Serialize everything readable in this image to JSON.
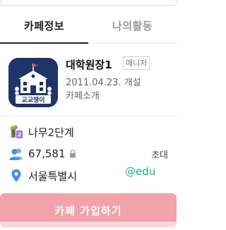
{
  "tabs": [
    {
      "label": "카페정보",
      "active": true
    },
    {
      "label": "나의활동",
      "active": false
    }
  ],
  "profile": {
    "logo_text": "교교쟁이",
    "name": "대학원장1",
    "role": "매니저",
    "created": "2011.04.23. 개설",
    "intro_link": "카페소개"
  },
  "info": {
    "level": "나무2단계",
    "level_icon": "tree-level-icon",
    "members": "67,581",
    "members_icon": "members-icon",
    "invite": "초대",
    "location": "서울특별시",
    "location_icon": "location-pin-icon"
  },
  "watermark": "@edu",
  "join_button": "카페 가입하기",
  "colors": {
    "join_button_bg": "#f2a2ab",
    "icon_blue": "#4a90e2",
    "watermark": "#1bb58c",
    "logo_bg": "#1f3569"
  }
}
